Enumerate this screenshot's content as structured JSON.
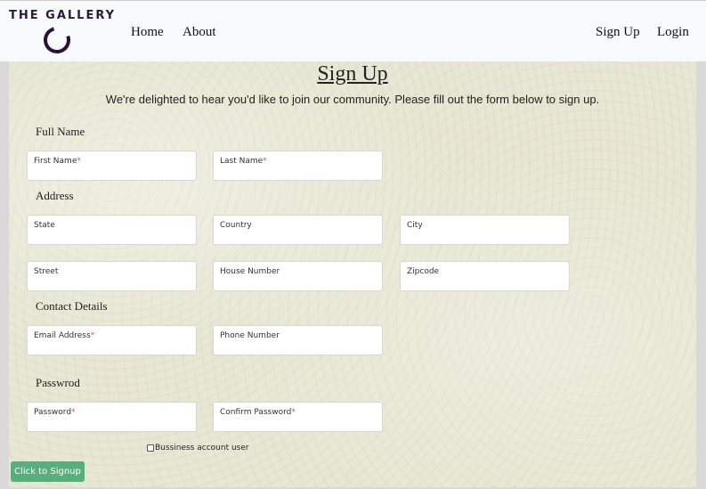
{
  "brand": {
    "name": "THE GALLERY",
    "accent": "#3a1d52"
  },
  "nav": {
    "home": "Home",
    "about": "About",
    "signup": "Sign Up",
    "login": "Login"
  },
  "form": {
    "title": "Sign Up",
    "intro": "We're delighted to hear you'd like to join our community. Please fill out the form below to sign up.",
    "sections": {
      "full_name": "Full Name",
      "address": "Address",
      "contact": "Contact Details",
      "password": "Passwrod"
    },
    "fields": {
      "first_name": "First Name",
      "last_name": "Last Name",
      "state": "State",
      "country": "Country",
      "city": "City",
      "street": "Street",
      "house_number": "House Number",
      "zipcode": "Zipcode",
      "email": "Email Address",
      "phone": "Phone Number",
      "password": "Password",
      "confirm_password": "Confirm Password"
    },
    "required_mark": "*",
    "business_checkbox": {
      "label": "Bussiness account user",
      "checked": false
    },
    "submit_label": "Click to Signup"
  },
  "colors": {
    "required": "#d9534f",
    "submit": "#5bad7d",
    "form_background": "#e8e7d3"
  }
}
